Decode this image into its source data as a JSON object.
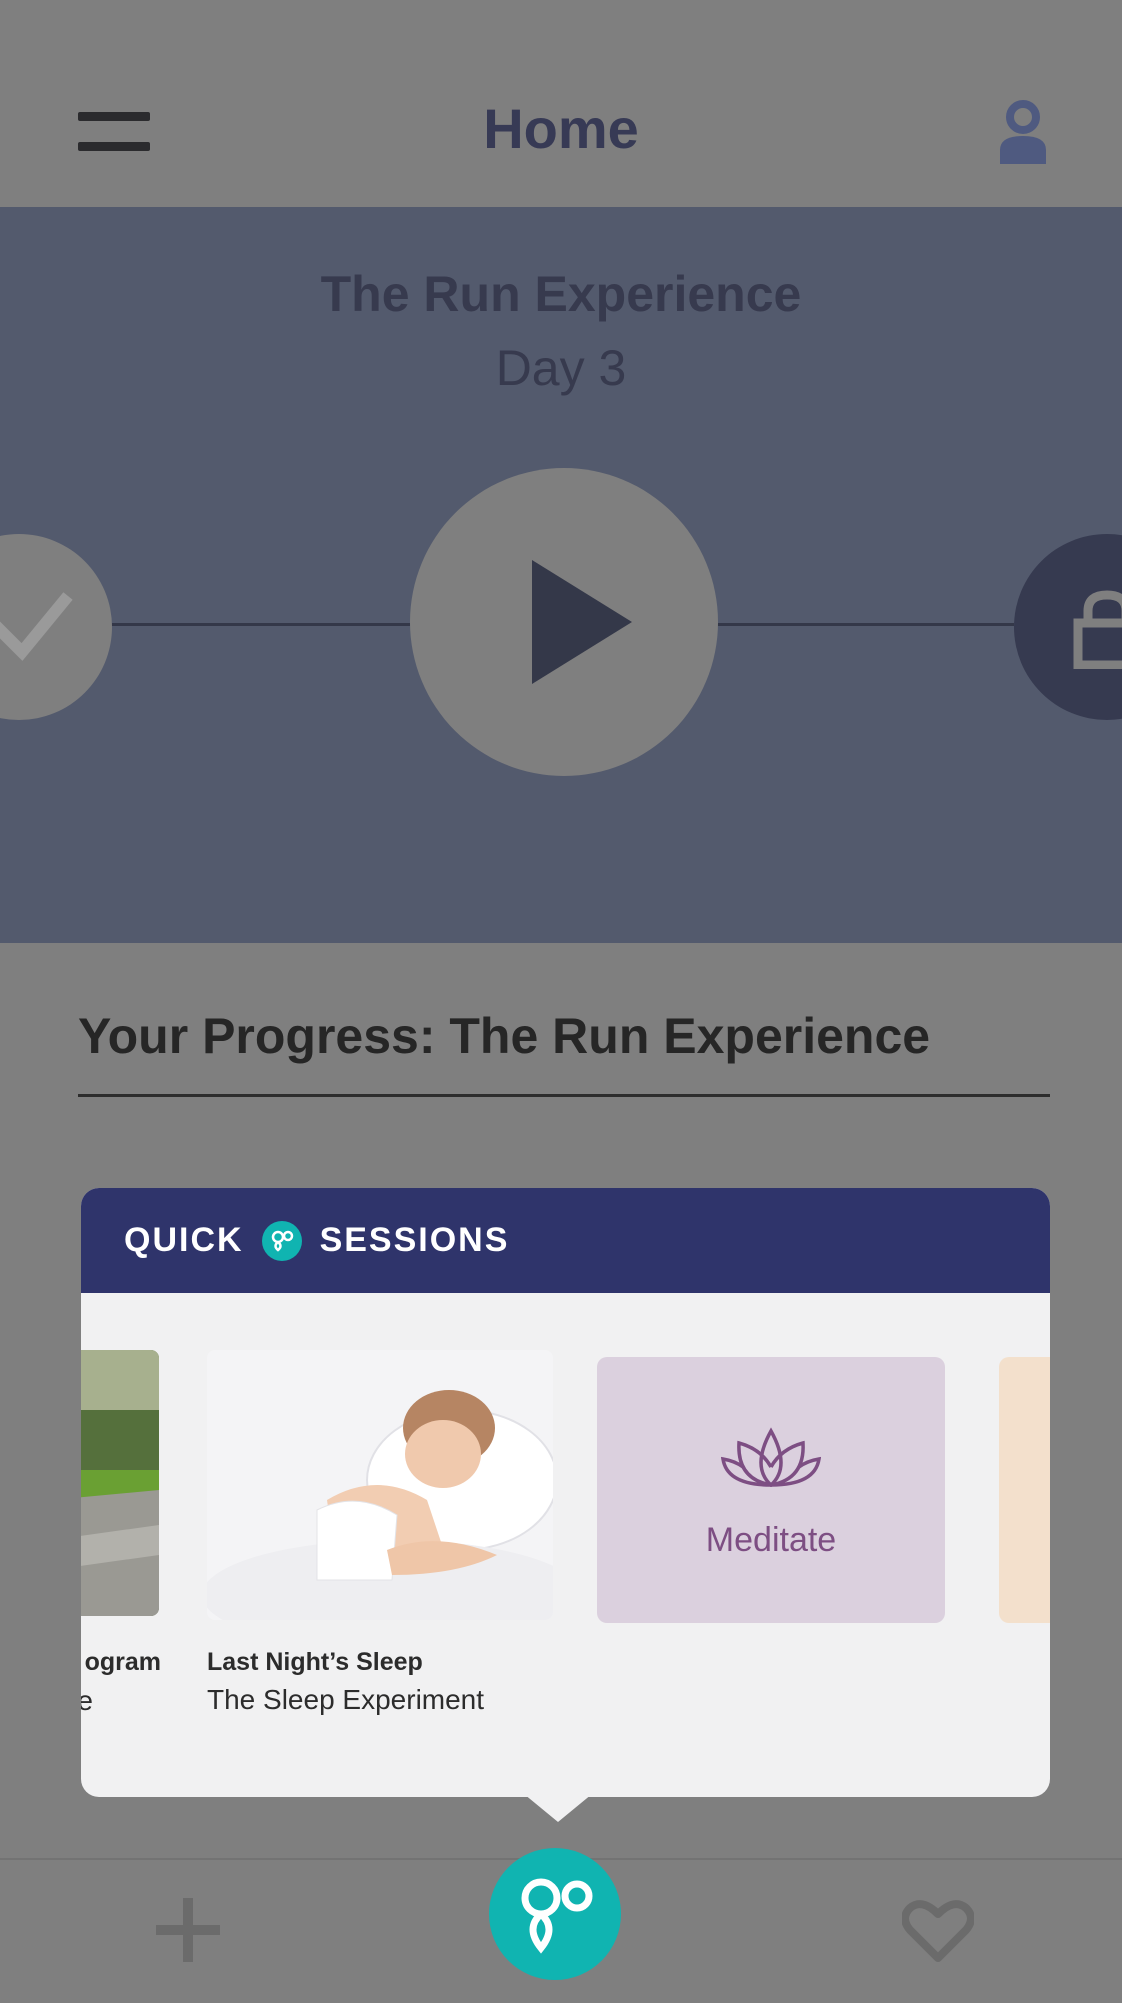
{
  "header": {
    "title": "Home",
    "menu_icon": "hamburger-menu-icon",
    "profile_icon": "user-profile-icon"
  },
  "program": {
    "title": "The Run Experience",
    "day": "Day 3",
    "icons": [
      "check-icon",
      "play-icon",
      "lock-icon"
    ]
  },
  "progress": {
    "heading": "Your Progress: The Run Experience"
  },
  "quick_sessions": {
    "title_left": "QUICK",
    "title_right": "SESSIONS",
    "cards": [
      {
        "title": "ogram",
        "subtitle": "e",
        "image": "road-landscape-photo"
      },
      {
        "title": "Last Night’s Sleep",
        "subtitle": "The Sleep Experiment",
        "image": "sleeping-woman-photo"
      },
      {
        "label": "Meditate",
        "icon": "lotus-icon"
      }
    ]
  },
  "bottom_nav": {
    "icons": [
      "plus-icon",
      "go-logo-icon",
      "heart-icon"
    ]
  },
  "colors": {
    "popup_header": "#2f346b",
    "accent_teal": "#10b4b1",
    "banner": "#535a6d",
    "meditate_tile": "#dbd0de",
    "meditate_text": "#7d4e83"
  }
}
